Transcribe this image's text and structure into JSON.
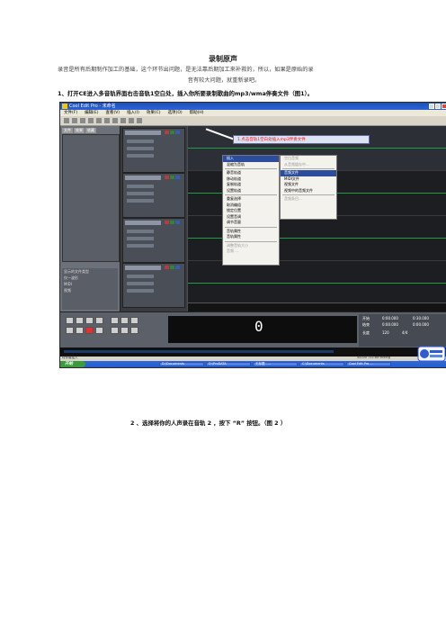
{
  "doc": {
    "title": "录制原声",
    "para_line1": "录音是所有后期制作加工的基础，这个环节出问题，是无法靠后期加工来补救的，所以，如果是原始的录",
    "para_line2": "音有较大问题，就重新录吧。",
    "step1": "1、打开CE进入多音轨界面右击音轨1空白处，插入你所要录制歌曲的mp3/wma伴奏文件（图1）。",
    "step2": "2 、选择将你的人声录在音轨 2 ，按下 “R” 按钮。（图 2 ）"
  },
  "screenshot": {
    "window_title": "Cool Edit Pro  - 未命名",
    "menus": [
      "文件(F)",
      "编辑(E)",
      "查看(V)",
      "插入(I)",
      "效果(C)",
      "选项(O)",
      "帮助(H)"
    ],
    "left_tabs": [
      "文件",
      "效果",
      "收藏"
    ],
    "left_bottom": [
      "显示的文件类型",
      "仅一波形",
      "MIDI",
      "视频"
    ],
    "callout_text": "1.点击音轨1空白处插入mp3伴奏文件",
    "context_menu": {
      "items": [
        {
          "label": "插入",
          "state": "highlight"
        },
        {
          "label": "混缩为音轨",
          "state": "normal"
        },
        {
          "label": "sep"
        },
        {
          "label": "静音轨道",
          "state": "normal"
        },
        {
          "label": "移动轨道",
          "state": "normal"
        },
        {
          "label": "复制轨道",
          "state": "normal"
        },
        {
          "label": "设置轨道",
          "state": "normal"
        },
        {
          "label": "sep"
        },
        {
          "label": "重复选择",
          "state": "normal"
        },
        {
          "label": "取消编组",
          "state": "normal"
        },
        {
          "label": "锁定位置",
          "state": "normal"
        },
        {
          "label": "设置音调",
          "state": "normal"
        },
        {
          "label": "调节音量",
          "state": "normal"
        },
        {
          "label": "sep"
        },
        {
          "label": "音轨属性",
          "state": "normal"
        },
        {
          "label": "音轨属性",
          "state": "normal"
        },
        {
          "label": "sep"
        },
        {
          "label": "调整音轨大小",
          "state": "dim"
        },
        {
          "label": "音频 ...",
          "state": "dim"
        }
      ]
    },
    "sub_menu": {
      "items": [
        {
          "label": "空白音频",
          "state": "dim"
        },
        {
          "label": "从音频缓存中...",
          "state": "dim"
        },
        {
          "label": "sep"
        },
        {
          "label": "音频文件",
          "state": "highlight"
        },
        {
          "label": "MIDI文件",
          "state": "normal"
        },
        {
          "label": "视频文件",
          "state": "normal"
        },
        {
          "label": "视频中的音频文件",
          "state": "normal"
        },
        {
          "label": "sep"
        },
        {
          "label": "音频条目...",
          "state": "dim"
        }
      ]
    },
    "time_display": "0",
    "right_info": {
      "begin_label": "开始",
      "end_label": "结束",
      "length_label": "长度",
      "sel_begin": "0:00.000",
      "sel_end": "0:00.000",
      "view_begin": "0:00.000",
      "view_end": "0:30.000",
      "bpm": "120",
      "zoom": "4/4"
    },
    "status_left": "将伴奏插入",
    "status_right": "44100 ?32-bit Mixing",
    "taskbar": {
      "start": "开始",
      "items": [
        "D:\\Documents",
        "D:\\ProDATA",
        "无标题 - ...",
        "C:\\Documents",
        "Cool Edit Pro ..."
      ]
    }
  }
}
